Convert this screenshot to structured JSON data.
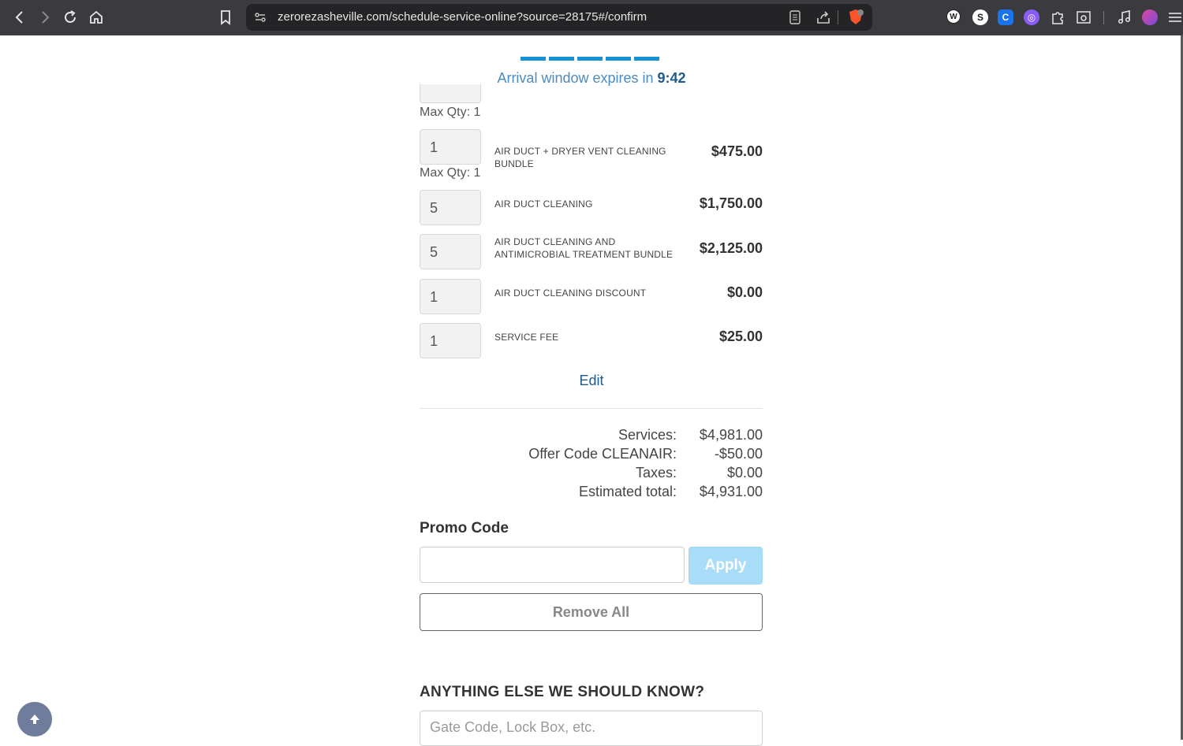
{
  "browser": {
    "url": "zerorezasheville.com/schedule-service-online?source=28175#/confirm",
    "extensions": [
      "wikipedia-icon",
      "s-icon",
      "c-icon",
      "vpn-icon",
      "puzzle-icon",
      "tab-search-icon",
      "music-icon",
      "profile-icon",
      "menu-icon"
    ],
    "brave_badge": "4"
  },
  "header": {
    "arrival_text": "Arrival window expires in ",
    "arrival_time": "9:42",
    "progress_steps": 5
  },
  "items": [
    {
      "max_qty": "Max Qty: 1"
    },
    {
      "qty": "1",
      "name": "AIR DUCT + DRYER VENT CLEANING BUNDLE",
      "price": "$475.00",
      "max_qty": "Max Qty: 1"
    },
    {
      "qty": "5",
      "name": "AIR DUCT CLEANING",
      "price": "$1,750.00"
    },
    {
      "qty": "5",
      "name": "AIR DUCT CLEANING AND ANTIMICROBIAL TREATMENT BUNDLE",
      "price": "$2,125.00"
    },
    {
      "qty": "1",
      "name": "AIR DUCT CLEANING DISCOUNT",
      "price": "$0.00"
    },
    {
      "qty": "1",
      "name": "SERVICE FEE",
      "price": "$25.00"
    }
  ],
  "edit_label": "Edit",
  "summary": {
    "services_label": "Services:",
    "services_value": "$4,981.00",
    "offer_label": "Offer Code CLEANAIR:",
    "offer_value": "-$50.00",
    "taxes_label": "Taxes:",
    "taxes_value": "$0.00",
    "total_label": "Estimated total:",
    "total_value": "$4,931.00"
  },
  "promo": {
    "title": "Promo Code",
    "input_value": "",
    "apply_label": "Apply",
    "remove_all_label": "Remove All"
  },
  "notes": {
    "title": "ANYTHING ELSE WE SHOULD KNOW?",
    "placeholder": "Gate Code, Lock Box, etc."
  },
  "colors": {
    "accent": "#1593d4",
    "link": "#1f5a8a",
    "apply_bg": "#a9dcf6"
  }
}
